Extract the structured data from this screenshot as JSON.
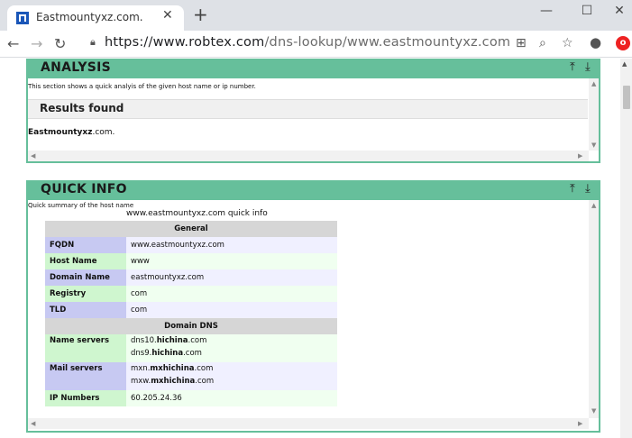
{
  "browser": {
    "tab_title": "Eastmountyxz.com.",
    "url_host": "https://www.robtex.com",
    "url_rest": "/dns-lookup/www.eastmountyxz.com"
  },
  "analysis": {
    "title": "ANALYSIS",
    "description": "This section shows a quick analyis of the given host name or ip number.",
    "results_title": "Results found",
    "result_main": "Eastmountyxz",
    "result_suffix": ".com."
  },
  "quick_info": {
    "title": "QUICK INFO",
    "description": "Quick summary of the host name",
    "caption": "www.eastmountyxz.com quick info",
    "general_header": "General",
    "fqdn_label": "FQDN",
    "fqdn_value": "www.eastmountyxz.com",
    "hostname_label": "Host Name",
    "hostname_value": "www",
    "domain_label": "Domain Name",
    "domain_value": "eastmountyxz.com",
    "registry_label": "Registry",
    "registry_value": "com",
    "tld_label": "TLD",
    "tld_value": "com",
    "dns_header": "Domain DNS",
    "ns_label": "Name servers",
    "ns1_prefix": "dns10.",
    "ns1_bold": "hichina",
    "ns1_suffix": ".com",
    "ns2_prefix": "dns9.",
    "ns2_bold": "hichina",
    "ns2_suffix": ".com",
    "mail_label": "Mail servers",
    "mx1_prefix": "mxn.",
    "mx1_bold": "mxhichina",
    "mx1_suffix": ".com",
    "mx2_prefix": "mxw.",
    "mx2_bold": "mxhichina",
    "mx2_suffix": ".com",
    "ip_label": "IP Numbers",
    "ip_value": "60.205.24.36"
  },
  "icons": {
    "top": "⤒",
    "bottom": "⤓"
  }
}
